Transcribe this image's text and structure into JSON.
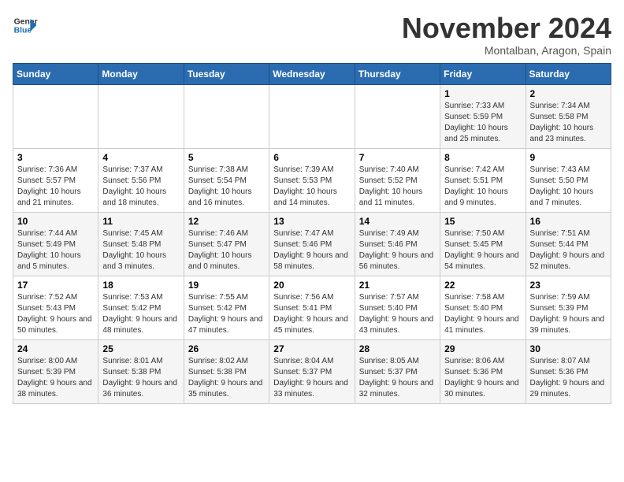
{
  "header": {
    "logo_line1": "General",
    "logo_line2": "Blue",
    "month_title": "November 2024",
    "subtitle": "Montalban, Aragon, Spain"
  },
  "weekdays": [
    "Sunday",
    "Monday",
    "Tuesday",
    "Wednesday",
    "Thursday",
    "Friday",
    "Saturday"
  ],
  "weeks": [
    [
      {
        "day": "",
        "info": ""
      },
      {
        "day": "",
        "info": ""
      },
      {
        "day": "",
        "info": ""
      },
      {
        "day": "",
        "info": ""
      },
      {
        "day": "",
        "info": ""
      },
      {
        "day": "1",
        "info": "Sunrise: 7:33 AM\nSunset: 5:59 PM\nDaylight: 10 hours and 25 minutes."
      },
      {
        "day": "2",
        "info": "Sunrise: 7:34 AM\nSunset: 5:58 PM\nDaylight: 10 hours and 23 minutes."
      }
    ],
    [
      {
        "day": "3",
        "info": "Sunrise: 7:36 AM\nSunset: 5:57 PM\nDaylight: 10 hours and 21 minutes."
      },
      {
        "day": "4",
        "info": "Sunrise: 7:37 AM\nSunset: 5:56 PM\nDaylight: 10 hours and 18 minutes."
      },
      {
        "day": "5",
        "info": "Sunrise: 7:38 AM\nSunset: 5:54 PM\nDaylight: 10 hours and 16 minutes."
      },
      {
        "day": "6",
        "info": "Sunrise: 7:39 AM\nSunset: 5:53 PM\nDaylight: 10 hours and 14 minutes."
      },
      {
        "day": "7",
        "info": "Sunrise: 7:40 AM\nSunset: 5:52 PM\nDaylight: 10 hours and 11 minutes."
      },
      {
        "day": "8",
        "info": "Sunrise: 7:42 AM\nSunset: 5:51 PM\nDaylight: 10 hours and 9 minutes."
      },
      {
        "day": "9",
        "info": "Sunrise: 7:43 AM\nSunset: 5:50 PM\nDaylight: 10 hours and 7 minutes."
      }
    ],
    [
      {
        "day": "10",
        "info": "Sunrise: 7:44 AM\nSunset: 5:49 PM\nDaylight: 10 hours and 5 minutes."
      },
      {
        "day": "11",
        "info": "Sunrise: 7:45 AM\nSunset: 5:48 PM\nDaylight: 10 hours and 3 minutes."
      },
      {
        "day": "12",
        "info": "Sunrise: 7:46 AM\nSunset: 5:47 PM\nDaylight: 10 hours and 0 minutes."
      },
      {
        "day": "13",
        "info": "Sunrise: 7:47 AM\nSunset: 5:46 PM\nDaylight: 9 hours and 58 minutes."
      },
      {
        "day": "14",
        "info": "Sunrise: 7:49 AM\nSunset: 5:46 PM\nDaylight: 9 hours and 56 minutes."
      },
      {
        "day": "15",
        "info": "Sunrise: 7:50 AM\nSunset: 5:45 PM\nDaylight: 9 hours and 54 minutes."
      },
      {
        "day": "16",
        "info": "Sunrise: 7:51 AM\nSunset: 5:44 PM\nDaylight: 9 hours and 52 minutes."
      }
    ],
    [
      {
        "day": "17",
        "info": "Sunrise: 7:52 AM\nSunset: 5:43 PM\nDaylight: 9 hours and 50 minutes."
      },
      {
        "day": "18",
        "info": "Sunrise: 7:53 AM\nSunset: 5:42 PM\nDaylight: 9 hours and 48 minutes."
      },
      {
        "day": "19",
        "info": "Sunrise: 7:55 AM\nSunset: 5:42 PM\nDaylight: 9 hours and 47 minutes."
      },
      {
        "day": "20",
        "info": "Sunrise: 7:56 AM\nSunset: 5:41 PM\nDaylight: 9 hours and 45 minutes."
      },
      {
        "day": "21",
        "info": "Sunrise: 7:57 AM\nSunset: 5:40 PM\nDaylight: 9 hours and 43 minutes."
      },
      {
        "day": "22",
        "info": "Sunrise: 7:58 AM\nSunset: 5:40 PM\nDaylight: 9 hours and 41 minutes."
      },
      {
        "day": "23",
        "info": "Sunrise: 7:59 AM\nSunset: 5:39 PM\nDaylight: 9 hours and 39 minutes."
      }
    ],
    [
      {
        "day": "24",
        "info": "Sunrise: 8:00 AM\nSunset: 5:39 PM\nDaylight: 9 hours and 38 minutes."
      },
      {
        "day": "25",
        "info": "Sunrise: 8:01 AM\nSunset: 5:38 PM\nDaylight: 9 hours and 36 minutes."
      },
      {
        "day": "26",
        "info": "Sunrise: 8:02 AM\nSunset: 5:38 PM\nDaylight: 9 hours and 35 minutes."
      },
      {
        "day": "27",
        "info": "Sunrise: 8:04 AM\nSunset: 5:37 PM\nDaylight: 9 hours and 33 minutes."
      },
      {
        "day": "28",
        "info": "Sunrise: 8:05 AM\nSunset: 5:37 PM\nDaylight: 9 hours and 32 minutes."
      },
      {
        "day": "29",
        "info": "Sunrise: 8:06 AM\nSunset: 5:36 PM\nDaylight: 9 hours and 30 minutes."
      },
      {
        "day": "30",
        "info": "Sunrise: 8:07 AM\nSunset: 5:36 PM\nDaylight: 9 hours and 29 minutes."
      }
    ]
  ]
}
